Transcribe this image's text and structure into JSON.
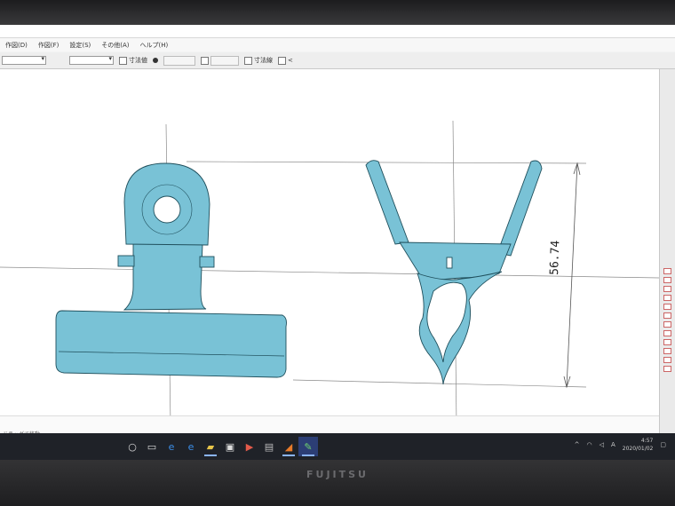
{
  "menubar": {
    "items": [
      "作図(D)",
      "作図(F)",
      "設定(S)",
      "その他(A)",
      "ヘルプ(H)"
    ]
  },
  "toolbar": {
    "checks": [
      "寸法値",
      "寸法線",
      "<"
    ]
  },
  "drawing": {
    "dimension_value": "56.74",
    "fill_color": "#79c2d6",
    "stroke_color": "#1f4f5c",
    "centerline_color": "#8a8a8a"
  },
  "statusbar": {
    "line2": "ドラッグで移動"
  },
  "taskbar": {
    "icons": [
      "start-icon",
      "task-view-icon",
      "edge-icon",
      "ie-icon",
      "folder-icon",
      "store-icon",
      "media-icon",
      "photos-icon",
      "jww-icon",
      "app-icon"
    ]
  },
  "tray": {
    "ime": "A",
    "time": "4:57",
    "date": "2020/01/02"
  },
  "hardware": {
    "brand": "FUJITSU"
  }
}
